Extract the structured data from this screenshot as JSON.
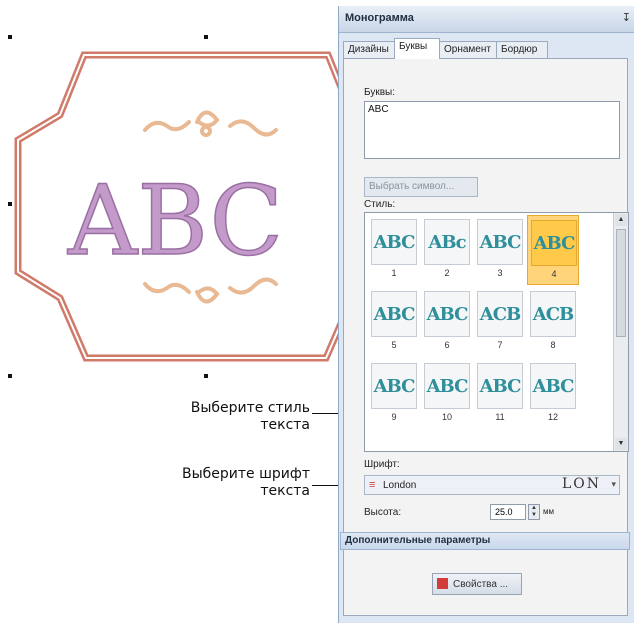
{
  "canvas": {
    "monogram_letters": "ABC",
    "colors": {
      "frame": "#d07a6a",
      "letters": "#c49acb",
      "ornament": "#e8b993"
    }
  },
  "callouts": {
    "style": "Выберите стиль\nтекста",
    "font": "Выберите шрифт\nтекста"
  },
  "panel": {
    "title": "Монограмма",
    "pin_icon": "pin-icon",
    "tabs": [
      {
        "label": "Дизайны",
        "active": false
      },
      {
        "label": "Буквы",
        "active": true
      },
      {
        "label": "Орнамент",
        "active": false
      },
      {
        "label": "Бордюр",
        "active": false
      }
    ],
    "letters_label": "Буквы:",
    "letters_value": "ABC",
    "select_symbol_button": "Выбрать символ...",
    "styles_label": "Стиль:",
    "styles": [
      {
        "number": "1",
        "sample": "ABC"
      },
      {
        "number": "2",
        "sample": "ABc"
      },
      {
        "number": "3",
        "sample": "ABC"
      },
      {
        "number": "4",
        "sample": "ABC",
        "selected": true
      },
      {
        "number": "5",
        "sample": "ABC"
      },
      {
        "number": "6",
        "sample": "ABC"
      },
      {
        "number": "7",
        "sample": "ACB"
      },
      {
        "number": "8",
        "sample": "ACB"
      },
      {
        "number": "9",
        "sample": "ABC"
      },
      {
        "number": "10",
        "sample": "ABC"
      },
      {
        "number": "11",
        "sample": "ABC"
      },
      {
        "number": "12",
        "sample": "ABC"
      }
    ],
    "font_label": "Шрифт:",
    "font_name": "London",
    "font_preview": "LON",
    "height_label": "Высота:",
    "height_value": "25.0",
    "height_unit": "мм",
    "advanced_label": "Дополнительные параметры",
    "properties_button": "Свойства ..."
  }
}
